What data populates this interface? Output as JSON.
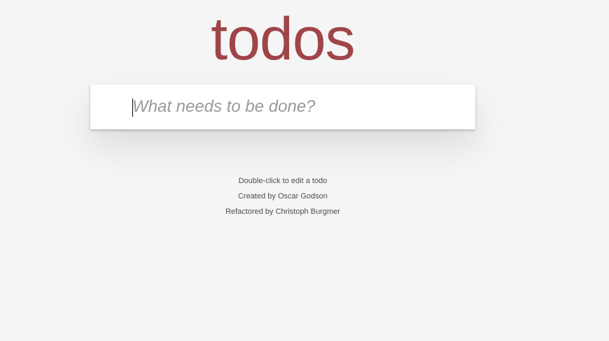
{
  "header": {
    "title": "todos"
  },
  "new_todo": {
    "placeholder": "What needs to be done?",
    "value": ""
  },
  "footer_info": {
    "hint": "Double-click to edit a todo",
    "created_by": "Created by Oscar Godson",
    "refactored_by": "Refactored by Christoph Burgmer"
  },
  "colors": {
    "title": "#9f4549",
    "background": "#f5f5f5",
    "panel": "#ffffff",
    "placeholder": "#9a9a9a"
  }
}
